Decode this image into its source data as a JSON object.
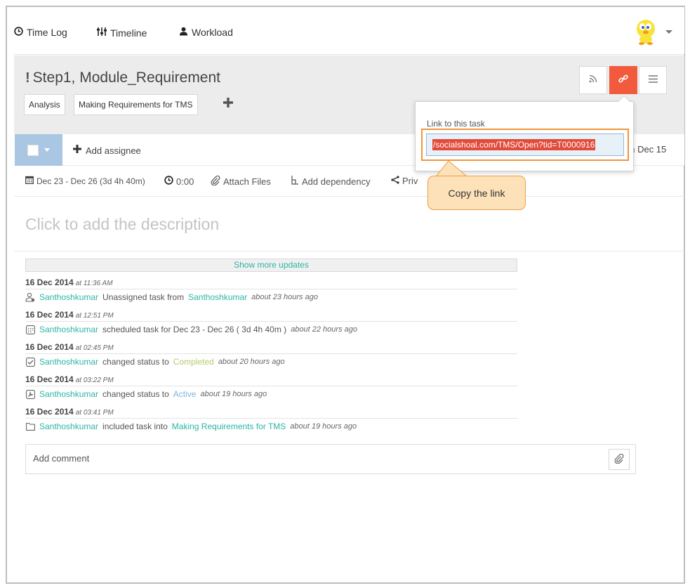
{
  "nav": {
    "timelog": "Time Log",
    "timeline": "Timeline",
    "workload": "Workload"
  },
  "task": {
    "title": "Step1, Module_Requirement",
    "tags": [
      "Analysis",
      "Making Requirements for TMS"
    ]
  },
  "assign": {
    "add_assignee": "Add assignee",
    "on_date": "on Dec 15"
  },
  "meta": {
    "dates": "Dec 23 - Dec 26 (3d 4h 40m)",
    "time": "0:00",
    "attach": "Attach Files",
    "dependency": "Add dependency",
    "privacy": "Priv"
  },
  "description_placeholder": "Click to add the description",
  "updates": {
    "show_more": "Show more updates",
    "items": [
      {
        "date": "16 Dec 2014",
        "time": "at 11:36 AM",
        "user": "Santhoshkumar",
        "text": "Unassigned task from",
        "target": "Santhoshkumar",
        "ago": "about 23 hours ago"
      },
      {
        "date": "16 Dec 2014",
        "time": "at 12:51 PM",
        "user": "Santhoshkumar",
        "text": "scheduled task for Dec 23 - Dec 26 ( 3d 4h 40m )",
        "ago": "about 22 hours ago"
      },
      {
        "date": "16 Dec 2014",
        "time": "at 02:45 PM",
        "user": "Santhoshkumar",
        "text": "changed status to",
        "status": "Completed",
        "ago": "about 20 hours ago"
      },
      {
        "date": "16 Dec 2014",
        "time": "at 03:22 PM",
        "user": "Santhoshkumar",
        "text": "changed status to",
        "status": "Active",
        "ago": "about 19 hours ago"
      },
      {
        "date": "16 Dec 2014",
        "time": "at 03:41 PM",
        "user": "Santhoshkumar",
        "text": "included task into",
        "target": "Making Requirements for TMS",
        "ago": "about 19 hours ago"
      }
    ]
  },
  "comment": {
    "placeholder": "Add comment"
  },
  "popover": {
    "label": "Link to this task",
    "url": "/socialshoal.com/TMS/Open?tid=T0000916"
  },
  "callout": "Copy the link",
  "colors": {
    "accent_teal": "#2bb5a5",
    "link_button": "#f15a3c",
    "completed": "#b5cc6a",
    "active": "#7fb3dc",
    "callout_border": "#ef9b45"
  }
}
